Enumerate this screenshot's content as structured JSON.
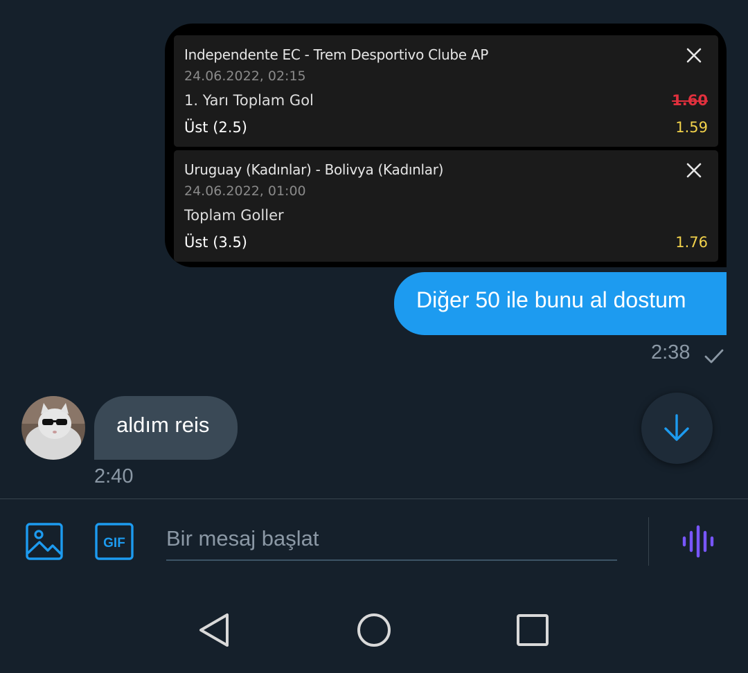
{
  "bet_slip": {
    "bets": [
      {
        "match": "Independente EC - Trem Desportivo Clube AP",
        "date": "24.06.2022, 02:15",
        "market": "1. Yarı Toplam Gol",
        "selection": "Üst (2.5)",
        "old_odd": "1.60",
        "odd": "1.59"
      },
      {
        "match": "Uruguay (Kadınlar) - Bolivya (Kadınlar)",
        "date": "24.06.2022, 01:00",
        "market": "Toplam Goller",
        "selection": "Üst (3.5)",
        "odd": "1.76"
      }
    ]
  },
  "sent_message": {
    "text": "Diğer 50 ile bunu al dostum",
    "time": "2:38",
    "status_icon": "check-icon"
  },
  "received_message": {
    "text": "aldım reis",
    "time": "2:40",
    "avatar": "cat-with-sunglasses"
  },
  "composer": {
    "placeholder": "Bir mesaj başlat",
    "gif_label": "GIF",
    "media_icon": "image-icon",
    "voice_icon": "voice-waveform-icon"
  },
  "colors": {
    "background": "#15202b",
    "sent_bubble": "#1d9bf0",
    "received_bubble": "#3a4956",
    "accent": "#1d9bf0",
    "odd_color": "#f2d24b",
    "old_odd_color": "#e0303d",
    "voice_color": "#7856ff"
  },
  "nav": {
    "icons": [
      "back-icon",
      "home-icon",
      "recents-icon"
    ]
  }
}
